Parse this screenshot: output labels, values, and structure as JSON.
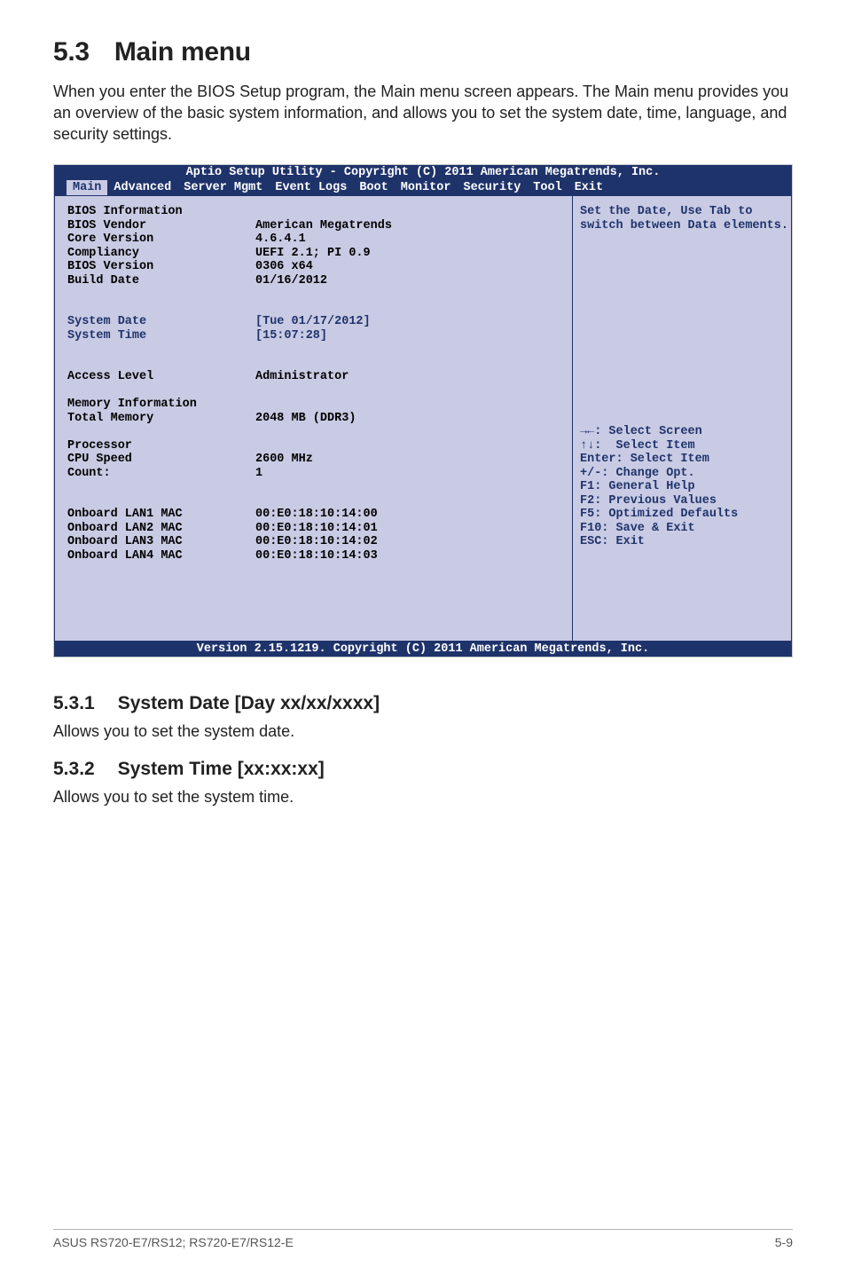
{
  "heading": {
    "num": "5.3",
    "title": "Main menu"
  },
  "intro": "When you enter the BIOS Setup program, the Main menu screen appears. The Main menu provides you an overview of the basic system information, and allows you to set the system date, time, language, and security settings.",
  "bios": {
    "titlebar": "Aptio Setup Utility - Copyright (C) 2011 American Megatrends, Inc.",
    "menu": {
      "items": [
        "Main",
        "Advanced",
        "Server Mgmt",
        "Event Logs",
        "Boot",
        "Monitor",
        "Security",
        "Tool",
        "Exit"
      ],
      "active_index": 0
    },
    "left_rows": [
      {
        "label": "BIOS Information",
        "value": "",
        "color": "black"
      },
      {
        "label": "BIOS Vendor",
        "value": "American Megatrends",
        "color": "black"
      },
      {
        "label": "Core Version",
        "value": "4.6.4.1",
        "color": "black"
      },
      {
        "label": "Compliancy",
        "value": "UEFI 2.1; PI 0.9",
        "color": "black"
      },
      {
        "label": "BIOS Version",
        "value": "0306 x64",
        "color": "black"
      },
      {
        "label": "Build Date",
        "value": "01/16/2012",
        "color": "black"
      },
      {
        "label": "",
        "value": "",
        "color": "black"
      },
      {
        "label": "",
        "value": "",
        "color": "black"
      },
      {
        "label": "System Date",
        "value": "[Tue 01/17/2012]",
        "color": "blue"
      },
      {
        "label": "System Time",
        "value": "[15:07:28]",
        "color": "blue"
      },
      {
        "label": "",
        "value": "",
        "color": "black"
      },
      {
        "label": "",
        "value": "",
        "color": "black"
      },
      {
        "label": "Access Level",
        "value": "Administrator",
        "color": "black"
      },
      {
        "label": "",
        "value": "",
        "color": "black"
      },
      {
        "label": "Memory Information",
        "value": "",
        "color": "black"
      },
      {
        "label": "Total Memory",
        "value": "2048 MB (DDR3)",
        "color": "black"
      },
      {
        "label": "",
        "value": "",
        "color": "black"
      },
      {
        "label": "Processor",
        "value": "",
        "color": "black"
      },
      {
        "label": "CPU Speed",
        "value": "2600 MHz",
        "color": "black"
      },
      {
        "label": "Count:",
        "value": "1",
        "color": "black"
      },
      {
        "label": "",
        "value": "",
        "color": "black"
      },
      {
        "label": "",
        "value": "",
        "color": "black"
      },
      {
        "label": "Onboard LAN1 MAC",
        "value": "00:E0:18:10:14:00",
        "color": "black"
      },
      {
        "label": "Onboard LAN2 MAC",
        "value": "00:E0:18:10:14:01",
        "color": "black"
      },
      {
        "label": "Onboard LAN3 MAC",
        "value": "00:E0:18:10:14:02",
        "color": "black"
      },
      {
        "label": "Onboard LAN4 MAC",
        "value": "00:E0:18:10:14:03",
        "color": "black"
      },
      {
        "label": "",
        "value": "",
        "color": "black"
      },
      {
        "label": "",
        "value": "",
        "color": "black"
      },
      {
        "label": "",
        "value": "",
        "color": "black"
      },
      {
        "label": "",
        "value": "",
        "color": "black"
      },
      {
        "label": "",
        "value": "",
        "color": "black"
      }
    ],
    "right_top": [
      "Set the Date, Use Tab to",
      "switch between Data elements."
    ],
    "right_help": [
      "→←: Select Screen",
      "↑↓:  Select Item",
      "Enter: Select Item",
      "+/-: Change Opt.",
      "F1: General Help",
      "F2: Previous Values",
      "F5: Optimized Defaults",
      "F10: Save & Exit",
      "ESC: Exit"
    ],
    "footer": "Version 2.15.1219. Copyright (C) 2011 American Megatrends, Inc."
  },
  "sub1": {
    "num": "5.3.1",
    "title": "System Date [Day xx/xx/xxxx]",
    "text": "Allows you to set the system date."
  },
  "sub2": {
    "num": "5.3.2",
    "title": "System Time [xx:xx:xx]",
    "text": "Allows you to set the system time."
  },
  "footer": {
    "left": "ASUS RS720-E7/RS12; RS720-E7/RS12-E",
    "right": "5-9"
  }
}
